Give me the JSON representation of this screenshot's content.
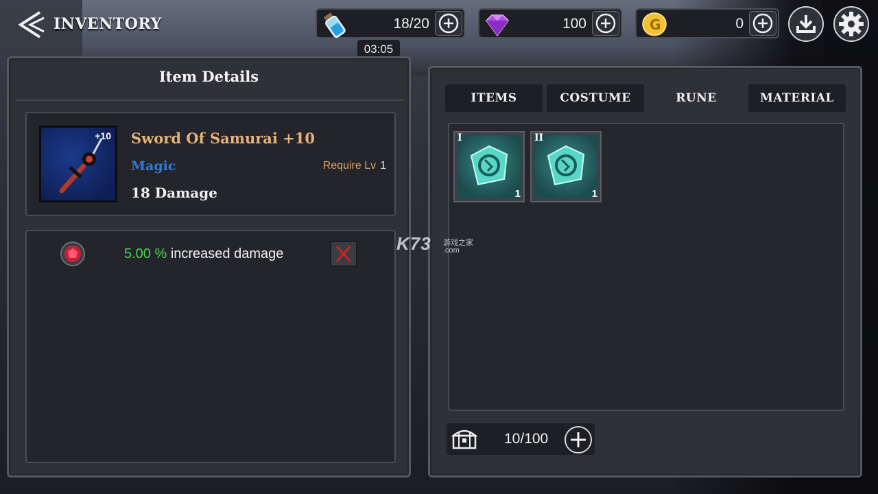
{
  "header": {
    "title": "INVENTORY",
    "energy": {
      "icon": "potion-icon",
      "value": "18/20",
      "timer": "03:05"
    },
    "gems": {
      "icon": "purple-gem-icon",
      "value": "100"
    },
    "gold": {
      "icon": "gold-coin-icon",
      "value": "0"
    }
  },
  "item_details": {
    "title": "Item Details",
    "item": {
      "icon": "samurai-sword-icon",
      "enhance": "+10",
      "name": "Sword Of Samurai +10",
      "type": "Magic",
      "require_label": "Require Lv",
      "require_value": "1",
      "damage": "18 Damage"
    },
    "stats": [
      {
        "gem_icon": "red-gem-icon",
        "value": "5.00 %",
        "text": "increased damage"
      }
    ]
  },
  "inventory": {
    "tabs": [
      {
        "label": "ITEMS",
        "active": false
      },
      {
        "label": "COSTUME",
        "active": false
      },
      {
        "label": "RUNE",
        "active": true
      },
      {
        "label": "MATERIAL",
        "active": false
      }
    ],
    "slots": [
      {
        "tier": "I",
        "count": "1",
        "icon": "rune-stone-icon"
      },
      {
        "tier": "II",
        "count": "1",
        "icon": "rune-stone-icon"
      }
    ],
    "capacity": "10/100"
  },
  "watermark": {
    "main": "K73",
    "sub": "游戏之家",
    "domain": ".com"
  },
  "colors": {
    "item_name": "#e6b27a",
    "item_type": "#2f7bd8",
    "stat_value": "#4fd44f",
    "panel_bg": "#2f3137"
  }
}
